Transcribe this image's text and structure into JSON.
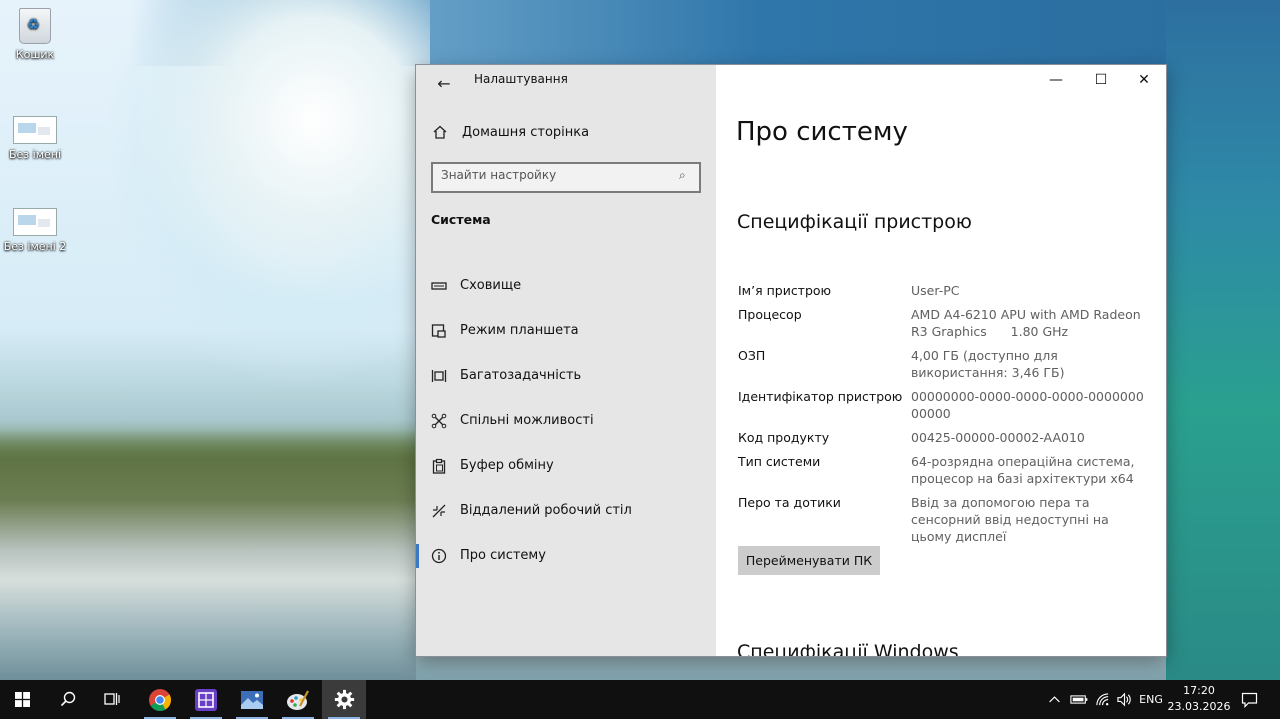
{
  "desktop": {
    "icons": [
      {
        "label": "Кошик",
        "icon": "recycle-bin-icon"
      },
      {
        "label": "Без імені",
        "icon": "image-file-icon"
      },
      {
        "label": "Без імені 2",
        "icon": "image-file-icon"
      }
    ]
  },
  "window": {
    "app_title": "Налаштування",
    "controls": {
      "minimize": "—",
      "maximize": "☐",
      "close": "✕"
    }
  },
  "sidebar": {
    "home_label": "Домашня сторінка",
    "search_placeholder": "Знайти настройку",
    "group_heading": "Система",
    "items": [
      {
        "label": "Сховище",
        "icon": "storage-icon"
      },
      {
        "label": "Режим планшета",
        "icon": "tablet-mode-icon"
      },
      {
        "label": "Багатозадачність",
        "icon": "multitasking-icon"
      },
      {
        "label": "Спільні можливості",
        "icon": "shared-experiences-icon"
      },
      {
        "label": "Буфер обміну",
        "icon": "clipboard-icon"
      },
      {
        "label": "Віддалений робочий стіл",
        "icon": "remote-desktop-icon"
      },
      {
        "label": "Про систему",
        "icon": "info-icon",
        "active": true
      }
    ]
  },
  "content": {
    "title": "Про систему",
    "device_specs_heading": "Специфікації пристрою",
    "specs": [
      {
        "key": "Ім’я пристрою",
        "value": "User-PC"
      },
      {
        "key": "Процесор",
        "value": "AMD A4-6210 APU with AMD Radeon R3 Graphics      1.80 GHz"
      },
      {
        "key": "ОЗП",
        "value": "4,00 ГБ (доступно для використання: 3,46 ГБ)"
      },
      {
        "key": "Ідентифікатор пристрою",
        "value": "00000000-0000-0000-0000-000000000000"
      },
      {
        "key": "Код продукту",
        "value": "00425-00000-00002-AA010"
      },
      {
        "key": "Тип системи",
        "value": "64-розрядна операційна система, процесор на базі архітектури x64"
      },
      {
        "key": "Перо та дотики",
        "value": "Ввід за допомогою пера та сенсорний ввід недоступні на цьому дисплеї"
      }
    ],
    "rename_button": "Перейменувати ПК",
    "windows_specs_heading": "Специфікації Windows"
  },
  "taskbar": {
    "language": "ENG",
    "time": "17:20",
    "date": "23.03.2026",
    "colors": {
      "background": "#101010",
      "accent": "#3a78c3"
    }
  }
}
